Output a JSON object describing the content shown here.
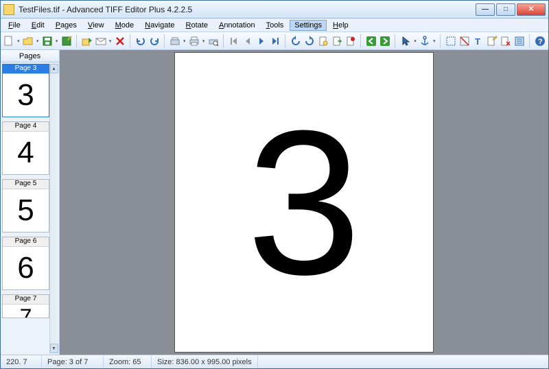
{
  "title": "TestFiles.tif - Advanced TIFF Editor Plus 4.2.2.5",
  "menu": {
    "file": "File",
    "edit": "Edit",
    "pages": "Pages",
    "view": "View",
    "mode": "Mode",
    "navigate": "Navigate",
    "rotate": "Rotate",
    "annotation": "Annotation",
    "tools": "Tools",
    "settings": "Settings",
    "help": "Help"
  },
  "sidebar": {
    "header": "Pages",
    "thumbs": [
      {
        "label": "Page 3",
        "glyph": "3",
        "selected": true
      },
      {
        "label": "Page 4",
        "glyph": "4",
        "selected": false
      },
      {
        "label": "Page 5",
        "glyph": "5",
        "selected": false
      },
      {
        "label": "Page 6",
        "glyph": "6",
        "selected": false
      },
      {
        "label": "Page 7",
        "glyph": "7",
        "selected": false,
        "cut": true
      }
    ]
  },
  "canvas": {
    "glyph": "3"
  },
  "status": {
    "coords": "220. 7",
    "page": "Page: 3 of 7",
    "zoom": "Zoom: 65",
    "size": "Size: 836.00 x 995.00 pixels"
  },
  "colors": {
    "accent": "#2a7de1",
    "titlebar": "#d3e5f7",
    "canvas_bg": "#8a8f97"
  }
}
